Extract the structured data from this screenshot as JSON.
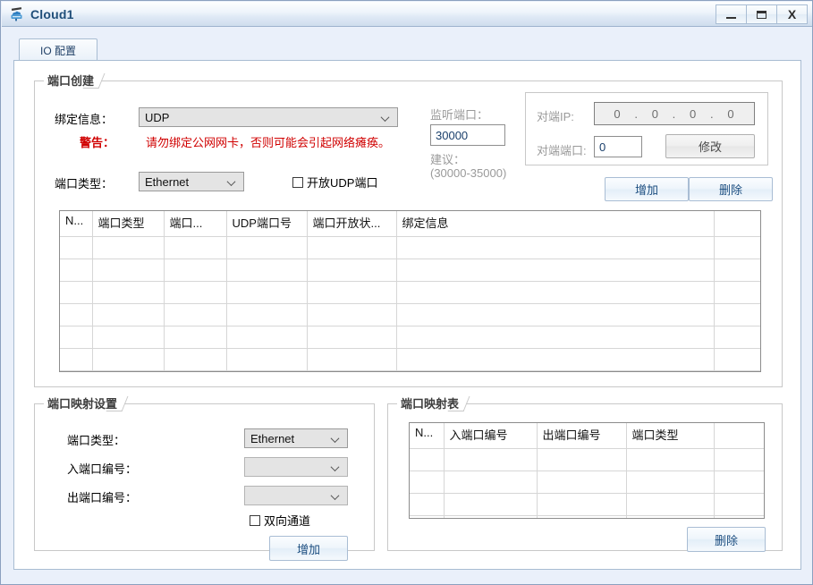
{
  "window": {
    "title": "Cloud1",
    "icon": "cloud-device-icon",
    "buttons": {
      "minimize": "minimize-icon",
      "maximize": "maximize-icon",
      "close": "X"
    }
  },
  "tabs": [
    {
      "label": "IO 配置",
      "active": true
    }
  ],
  "port_create": {
    "title": "端口创建",
    "bind_info_label": "绑定信息：",
    "bind_info_value": "UDP",
    "warning_label": "警告：",
    "warning_text": "请勿绑定公网网卡，否则可能会引起网络瘫痪。",
    "port_type_label": "端口类型：",
    "port_type_value": "Ethernet",
    "open_udp_checkbox": "开放UDP端口",
    "listen_port_label": "监听端口：",
    "listen_port_value": "30000",
    "suggest_label": "建议：",
    "suggest_range": "(30000-35000)",
    "peer_ip_label": "对端IP:",
    "peer_ip_octets": [
      "0",
      "0",
      "0",
      "0"
    ],
    "peer_port_label": "对端端口:",
    "peer_port_value": "0",
    "modify_button": "修改",
    "add_button": "增加",
    "delete_button": "删除",
    "table": {
      "headers": [
        "N...",
        "端口类型",
        "端口...",
        "UDP端口号",
        "端口开放状...",
        "绑定信息",
        ""
      ],
      "rows": []
    }
  },
  "map_setting": {
    "title": "端口映射设置",
    "port_type_label": "端口类型：",
    "port_type_value": "Ethernet",
    "in_port_label": "入端口编号：",
    "in_port_value": "",
    "out_port_label": "出端口编号：",
    "out_port_value": "",
    "bidirectional_checkbox": "双向通道",
    "add_button": "增加"
  },
  "map_table": {
    "title": "端口映射表",
    "headers": [
      "N...",
      "入端口编号",
      "出端口编号",
      "端口类型",
      ""
    ],
    "rows": [],
    "delete_button": "删除"
  },
  "colors": {
    "title_text": "#1f4e79",
    "warning": "#d00000",
    "button_text": "#1c4e80",
    "frame": "#a8bcd2"
  }
}
